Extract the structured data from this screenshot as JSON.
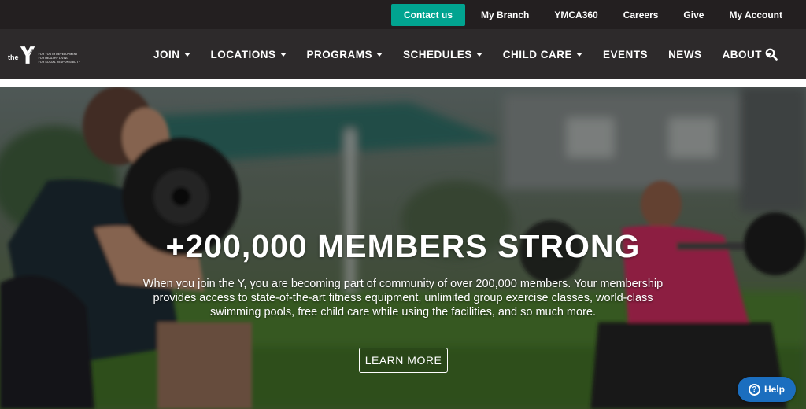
{
  "utility_nav": {
    "contact": "Contact us",
    "my_branch": "My Branch",
    "ymca360": "YMCA360",
    "careers": "Careers",
    "give": "Give",
    "my_account": "My Account"
  },
  "logo": {
    "the": "the",
    "tagline": [
      "FOR YOUTH DEVELOPMENT",
      "FOR HEALTHY LIVING",
      "FOR SOCIAL RESPONSIBILITY"
    ]
  },
  "main_nav": {
    "items": [
      {
        "label": "JOIN",
        "has_dropdown": true
      },
      {
        "label": "LOCATIONS",
        "has_dropdown": true
      },
      {
        "label": "PROGRAMS",
        "has_dropdown": true
      },
      {
        "label": "SCHEDULES",
        "has_dropdown": true
      },
      {
        "label": "CHILD CARE",
        "has_dropdown": true
      },
      {
        "label": "EVENTS",
        "has_dropdown": false
      },
      {
        "label": "NEWS",
        "has_dropdown": false
      },
      {
        "label": "ABOUT",
        "has_dropdown": true
      }
    ],
    "search_icon": "search-icon"
  },
  "hero": {
    "title": "+200,000 MEMBERS STRONG",
    "lines": [
      "When you join the Y, you are becoming part of community of over 200,000 members. Your membership",
      "provides access to state-of-the-art fitness equipment, unlimited group exercise classes, world-class",
      "swimming pools, free child care while using the facilities, and so much more."
    ],
    "cta": "LEARN MORE"
  },
  "help": {
    "label": "Help",
    "icon": "question-circle-icon"
  },
  "colors": {
    "topbar": "#231f20",
    "nav": "#2d2a2b",
    "contact_button": "#01a490",
    "help_button": "#1b6ebf"
  }
}
